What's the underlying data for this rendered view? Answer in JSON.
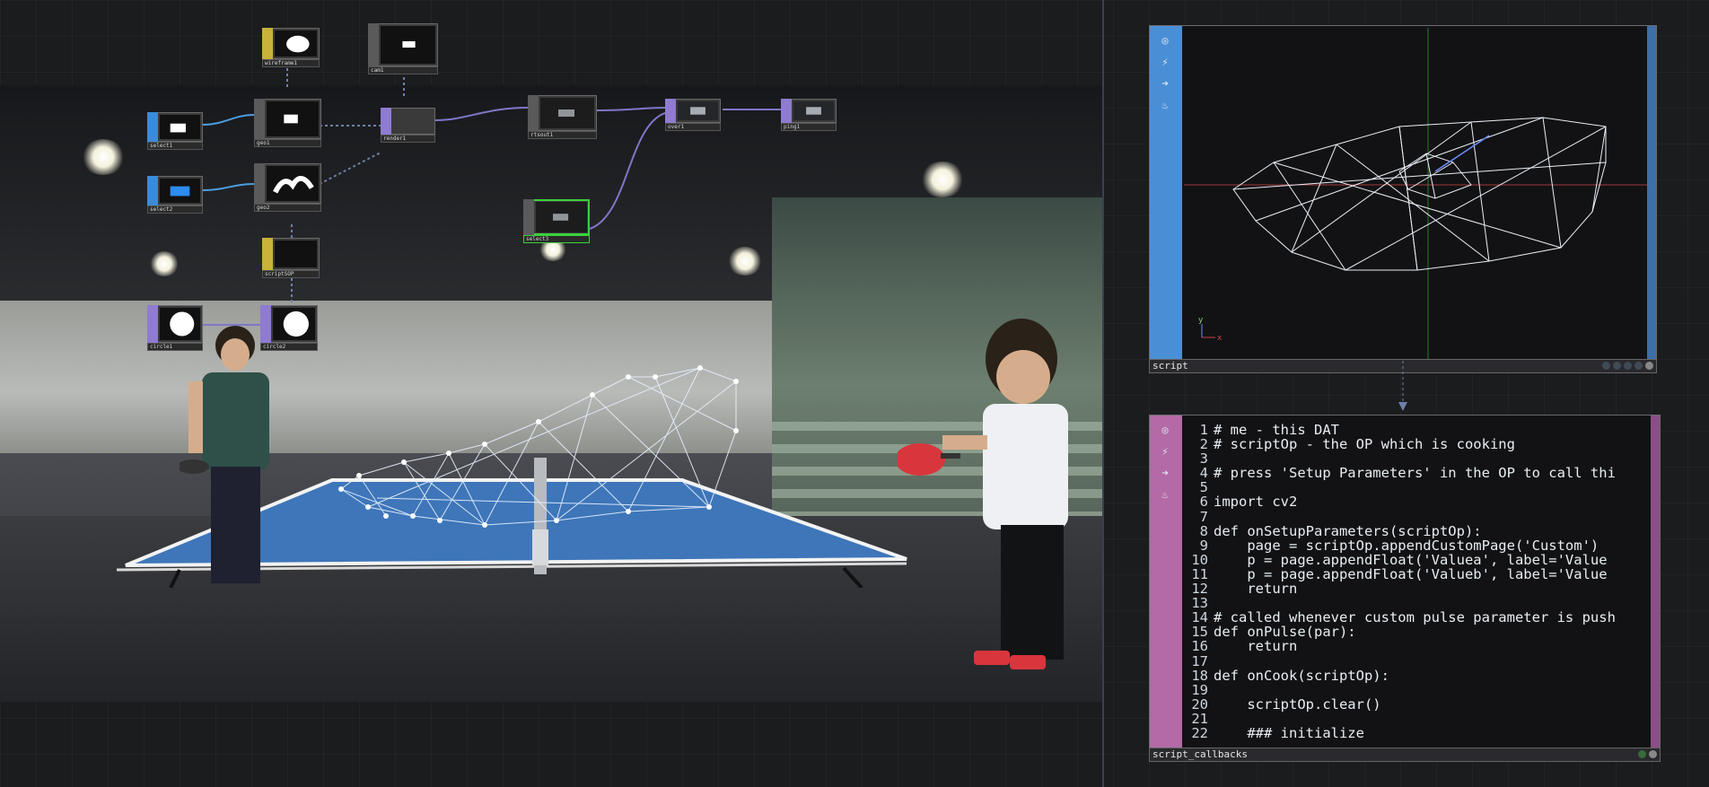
{
  "network": {
    "nodes": [
      {
        "id": "wireframe",
        "label": "wireframe1",
        "color": "#c8b23a"
      },
      {
        "id": "cam",
        "label": "cam1",
        "color": "#5a5a5a"
      },
      {
        "id": "select_a",
        "label": "select1",
        "color": "#3d8bd6"
      },
      {
        "id": "geo_a",
        "label": "geo1",
        "color": "#5a5a5a"
      },
      {
        "id": "render",
        "label": "render1",
        "color": "#8f7bd0"
      },
      {
        "id": "rtsout",
        "label": "rtsout1",
        "color": "#5a5a5a"
      },
      {
        "id": "over",
        "label": "over1",
        "color": "#8f7bd0"
      },
      {
        "id": "ping",
        "label": "ping1",
        "color": "#8f7bd0"
      },
      {
        "id": "select_b",
        "label": "select2",
        "color": "#3d8bd6"
      },
      {
        "id": "geo_b",
        "label": "geo2",
        "color": "#5a5a5a"
      },
      {
        "id": "select_c",
        "label": "select3",
        "color": "#5a5a5a"
      },
      {
        "id": "script_sop",
        "label": "scriptSOP",
        "color": "#c8b23a"
      },
      {
        "id": "circle_a",
        "label": "circle1",
        "color": "#8f7bd0"
      },
      {
        "id": "circle_b",
        "label": "circle2",
        "color": "#8f7bd0"
      }
    ]
  },
  "viewer_top": {
    "name": "script",
    "axis_labels": {
      "y": "y",
      "x": "x"
    },
    "side_icons": [
      "target-icon",
      "lightning-icon",
      "arrow-right-icon",
      "brush-icon"
    ]
  },
  "viewer_bottom": {
    "name": "script_callbacks",
    "side_icons": [
      "target-icon",
      "lightning-icon",
      "arrow-right-icon",
      "brush-icon"
    ],
    "code_lines": [
      {
        "n": "1",
        "t": "# me - this DAT"
      },
      {
        "n": "2",
        "t": "# scriptOp - the OP which is cooking"
      },
      {
        "n": "3",
        "t": ""
      },
      {
        "n": "4",
        "t": "# press 'Setup Parameters' in the OP to call thi"
      },
      {
        "n": "5",
        "t": ""
      },
      {
        "n": "6",
        "t": "import cv2"
      },
      {
        "n": "7",
        "t": ""
      },
      {
        "n": "8",
        "t": "def onSetupParameters(scriptOp):"
      },
      {
        "n": "9",
        "t": "    page = scriptOp.appendCustomPage('Custom')"
      },
      {
        "n": "10",
        "t": "    p = page.appendFloat('Valuea', label='Value"
      },
      {
        "n": "11",
        "t": "    p = page.appendFloat('Valueb', label='Value"
      },
      {
        "n": "12",
        "t": "    return"
      },
      {
        "n": "13",
        "t": ""
      },
      {
        "n": "14",
        "t": "# called whenever custom pulse parameter is push"
      },
      {
        "n": "15",
        "t": "def onPulse(par):"
      },
      {
        "n": "16",
        "t": "    return"
      },
      {
        "n": "17",
        "t": ""
      },
      {
        "n": "18",
        "t": "def onCook(scriptOp):"
      },
      {
        "n": "19",
        "t": ""
      },
      {
        "n": "20",
        "t": "    scriptOp.clear()"
      },
      {
        "n": "21",
        "t": ""
      },
      {
        "n": "22",
        "t": "    ### initialize"
      }
    ]
  },
  "colors": {
    "sop_blue": "#4a8fd6",
    "dat_pink": "#b46aa6",
    "selected_green": "#39d23a",
    "wire_purple": "#7e78c8",
    "wire_blue": "#4b9de0"
  }
}
